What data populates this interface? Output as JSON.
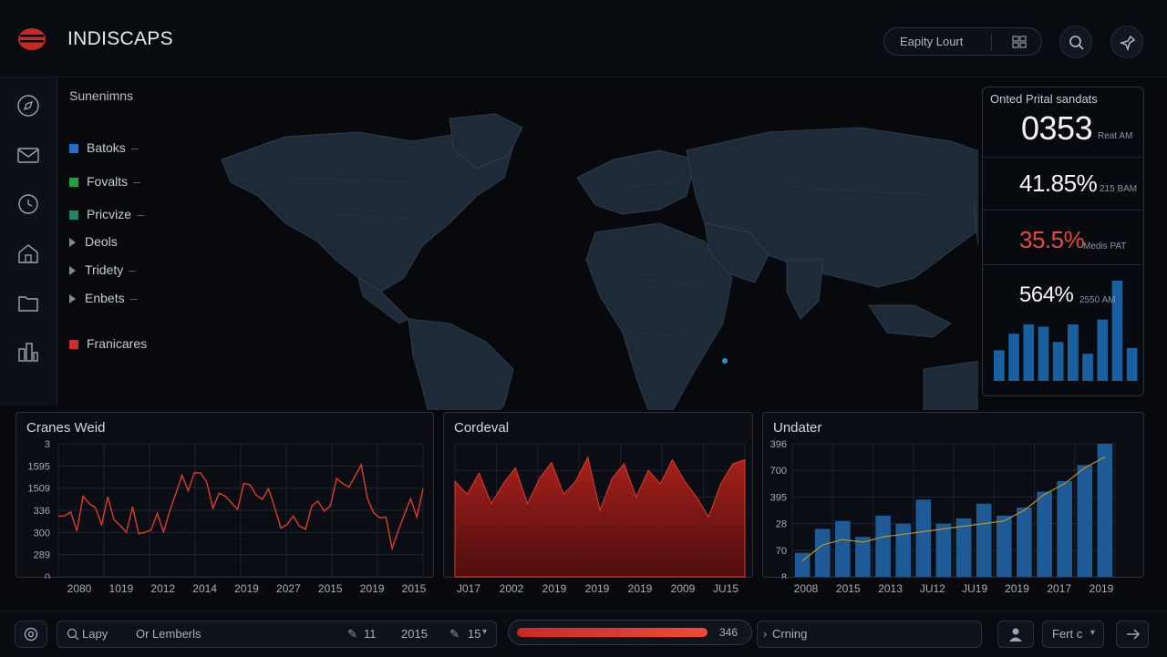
{
  "app": {
    "title": "INDISCAPS"
  },
  "header": {
    "pill_label": "Eapity Lourt"
  },
  "legend": {
    "title": "Sunenimns",
    "items": [
      {
        "label": "Batoks",
        "marker": "square",
        "color": "#1f6fd1"
      },
      {
        "label": "Fovalts",
        "marker": "square",
        "color": "#1fa33a"
      },
      {
        "label": "Pricvize",
        "marker": "square",
        "color": "#1b8a5c"
      },
      {
        "label": "Deols",
        "marker": "arrow"
      },
      {
        "label": "Tridety",
        "marker": "arrow"
      },
      {
        "label": "Enbets",
        "marker": "arrow"
      },
      {
        "label": "Franicares",
        "marker": "square",
        "color": "#d42b2b"
      }
    ]
  },
  "stats": {
    "title": "Onted Prital sandats",
    "rows": [
      {
        "value": "0353",
        "sub": "Reat AM",
        "color": "#f2f4f7"
      },
      {
        "value": "41.85%",
        "sub": "215 BAM",
        "color": "#f2f4f7"
      },
      {
        "value": "35.5%",
        "sub": "Medis PAT",
        "color": "#e5493f"
      },
      {
        "value": "564%",
        "sub": "2550 AM",
        "color": "#f2f4f7"
      }
    ],
    "bars": [
      26,
      40,
      48,
      46,
      33,
      48,
      23,
      52,
      85,
      28
    ]
  },
  "panels": {
    "left": {
      "title": "Cranes Weid",
      "y_ticks": [
        "3",
        "1595",
        "1509",
        "336",
        "300",
        "289",
        "0"
      ],
      "x_ticks": [
        "2080",
        "1019",
        "2012",
        "2014",
        "2019",
        "2027",
        "2015",
        "2019",
        "2015"
      ]
    },
    "middle": {
      "title": "Cordeval",
      "x_ticks": [
        "J017",
        "2002",
        "2019",
        "2019",
        "2019",
        "2009",
        "JU15"
      ]
    },
    "right": {
      "title": "Undater",
      "y_ticks": [
        "396",
        "700",
        "395",
        "28",
        "70",
        "8"
      ],
      "x_ticks": [
        "2008",
        "2015",
        "2013",
        "JU12",
        "JU19",
        "2019",
        "2017",
        "2019"
      ]
    }
  },
  "bottom": {
    "search_label": "Lapy",
    "search_value": "Or Lemberls",
    "count_a": "11",
    "count_b": "2015",
    "count_c": "15",
    "progress_value": "346",
    "progress_fraction": 0.78,
    "status_text": "Crning",
    "dropdown_label": "Fert c"
  },
  "chart_data": [
    {
      "type": "line",
      "title": "Cranes Weid",
      "categories": [
        "2080",
        "1019",
        "2012",
        "2014",
        "2019",
        "2027",
        "2015",
        "2019",
        "2015"
      ],
      "values": [
        300,
        336,
        300,
        289,
        400,
        336,
        370,
        289,
        336,
        400,
        270,
        360
      ],
      "color": "#e03a2c"
    },
    {
      "type": "area",
      "title": "Cordeval",
      "categories": [
        "J017",
        "2002",
        "2019",
        "2019",
        "2019",
        "2009",
        "JU15"
      ],
      "values": [
        0.72,
        0.62,
        0.78,
        0.55,
        0.7,
        0.82,
        0.55,
        0.74,
        0.86,
        0.62,
        0.72,
        0.9,
        0.5,
        0.74,
        0.85,
        0.6,
        0.8,
        0.7,
        0.88,
        0.72,
        0.6,
        0.45,
        0.7,
        0.85,
        0.88
      ],
      "color": "#b0221c"
    },
    {
      "type": "bar",
      "title": "Undater",
      "categories": [
        "2008",
        "2015",
        "2013",
        "JU12",
        "JU19",
        "2019",
        "2017",
        "2019"
      ],
      "values": [
        0.18,
        0.36,
        0.42,
        0.3,
        0.46,
        0.4,
        0.58,
        0.4,
        0.44,
        0.55,
        0.46,
        0.52,
        0.64,
        0.72,
        0.84,
        1.0
      ],
      "line": [
        0.12,
        0.24,
        0.28,
        0.26,
        0.3,
        0.32,
        0.34,
        0.36,
        0.38,
        0.4,
        0.42,
        0.5,
        0.62,
        0.7,
        0.82,
        0.9
      ],
      "color": "#1e5a95",
      "line_color": "#b8962a"
    }
  ]
}
